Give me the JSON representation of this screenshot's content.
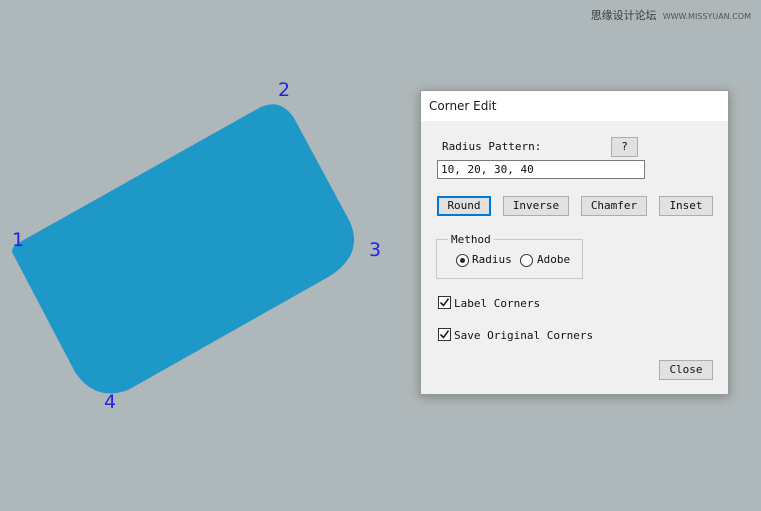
{
  "watermark": {
    "text": "思缘设计论坛",
    "url_text": "WWW.MISSYUAN.COM"
  },
  "canvas": {
    "shape_color": "#1e98c7",
    "corner_labels": [
      "1",
      "2",
      "3",
      "4"
    ],
    "label_color": "#2323e6"
  },
  "dialog": {
    "title": "Corner Edit",
    "radius_pattern_label": "Radius Pattern:",
    "help_button": "?",
    "radius_pattern_value": "10, 20, 30, 40",
    "buttons": {
      "round": "Round",
      "inverse": "Inverse",
      "chamfer": "Chamfer",
      "inset": "Inset",
      "close": "Close"
    },
    "method": {
      "legend": "Method",
      "options": [
        "Radius",
        "Adobe"
      ],
      "selected": "Radius"
    },
    "label_corners": {
      "label": "Label Corners",
      "checked": true
    },
    "save_original": {
      "label": "Save Original Corners",
      "checked": true
    }
  }
}
